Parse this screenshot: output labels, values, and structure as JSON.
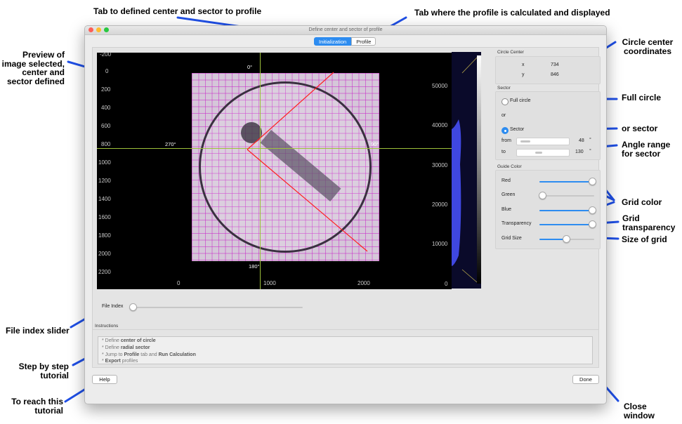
{
  "window": {
    "title": "Define center and sector of profile",
    "tabs": [
      {
        "label": "Initialization"
      },
      {
        "label": "Profile"
      }
    ]
  },
  "plot": {
    "y_ticks": [
      "-200",
      "0",
      "200",
      "400",
      "600",
      "800",
      "1000",
      "1200",
      "1400",
      "1600",
      "1800",
      "2000",
      "2200"
    ],
    "x_ticks": [
      "0",
      "1000",
      "2000"
    ],
    "angles": {
      "top": "0°",
      "left": "270°",
      "right": "90°",
      "bottom": "180°"
    }
  },
  "histogram": {
    "ticks": [
      "50000",
      "40000",
      "30000",
      "20000",
      "10000",
      "0"
    ]
  },
  "circle_center": {
    "label": "Circle Center",
    "x_label": "x",
    "x_value": "734",
    "y_label": "y",
    "y_value": "846"
  },
  "sector": {
    "label": "Sector",
    "full_circle_label": "Full circle",
    "or_label": "or",
    "sector_label": "Sector",
    "from_label": "from",
    "from_value": "48",
    "from_unit": "°",
    "to_label": "to",
    "to_value": "130",
    "to_unit": "°",
    "selected": "Sector"
  },
  "guide_color": {
    "label": "Guide Color",
    "sliders": [
      {
        "label": "Red",
        "level": 1.0
      },
      {
        "label": "Green",
        "level": 0.0
      },
      {
        "label": "Blue",
        "level": 1.0
      },
      {
        "label": "Transparency",
        "level": 1.0
      },
      {
        "label": "Grid Size",
        "level": 0.5
      }
    ]
  },
  "file_index": {
    "label": "File Index",
    "level": 0.0
  },
  "instructions": {
    "label": "Instructions",
    "lines": [
      {
        "prefix": "* Define ",
        "bold": "center of circle",
        "mid": "",
        "bold2": "",
        "suffix": ""
      },
      {
        "prefix": "* Define ",
        "bold": "radial sector",
        "mid": "",
        "bold2": "",
        "suffix": ""
      },
      {
        "prefix": "* Jump to ",
        "bold": "Profile",
        "mid": " tab and ",
        "bold2": "Run Calculation",
        "suffix": ""
      },
      {
        "prefix": "* ",
        "bold": "Export",
        "mid": " profiles",
        "bold2": "",
        "suffix": ""
      }
    ]
  },
  "buttons": {
    "help": "Help",
    "done": "Done"
  },
  "annotations": {
    "tab_defined_center": "Tab to defined center and sector to profile",
    "tab_profile": "Tab where the profile is calculated and displayed",
    "preview_1": "Preview of",
    "preview_2": "image selected,",
    "preview_3": "center and",
    "preview_4": "sector defined",
    "circle_center_1": "Circle center",
    "circle_center_2": "coordinates",
    "full_circle": "Full circle",
    "or_sector": "or sector",
    "angle_range_1": "Angle range",
    "angle_range_2": "for sector",
    "grid_color": "Grid color",
    "grid_transparency_1": "Grid",
    "grid_transparency_2": "transparency",
    "size_of_grid": "Size of grid",
    "file_index_slider": "File index slider",
    "step_by_step_1": "Step by step",
    "step_by_step_2": "tutorial",
    "to_reach_1": "To reach this",
    "to_reach_2": "tutorial",
    "close_1": "Close",
    "close_2": "window"
  }
}
